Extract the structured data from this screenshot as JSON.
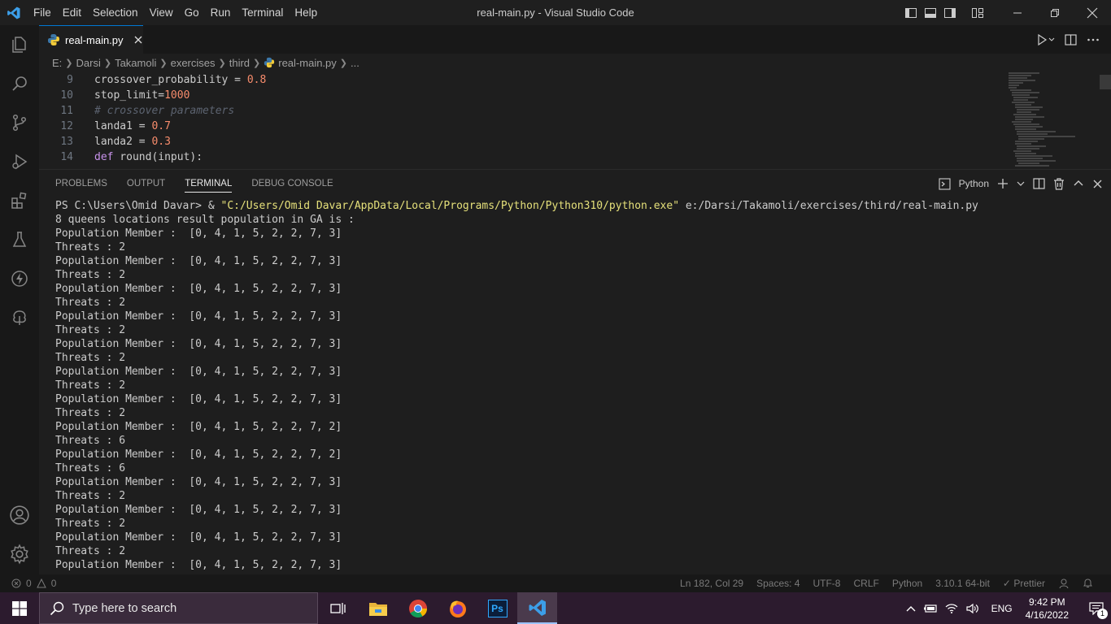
{
  "titlebar": {
    "menu": [
      "File",
      "Edit",
      "Selection",
      "View",
      "Go",
      "Run",
      "Terminal",
      "Help"
    ],
    "title": "real-main.py - Visual Studio Code"
  },
  "tab": {
    "label": "real-main.py"
  },
  "breadcrumb": [
    "E:",
    "Darsi",
    "Takamoli",
    "exercises",
    "third",
    "real-main.py",
    "..."
  ],
  "editor": {
    "lines": [
      {
        "n": "9",
        "pre": "crossover_probability = ",
        "val": "0.8"
      },
      {
        "n": "10",
        "pre": "stop_limit=",
        "val": "1000"
      },
      {
        "n": "11",
        "comment": "# crossover parameters"
      },
      {
        "n": "12",
        "pre": "landa1 = ",
        "val": "0.7"
      },
      {
        "n": "13",
        "pre": "landa2 = ",
        "val": "0.3"
      },
      {
        "n": "14",
        "kw": "def",
        "rest": " round(input):"
      }
    ]
  },
  "panel": {
    "tabs": [
      "PROBLEMS",
      "OUTPUT",
      "TERMINAL",
      "DEBUG CONSOLE"
    ],
    "active_tab": "TERMINAL",
    "shell": "Python"
  },
  "terminal": {
    "prompt": "PS C:\\Users\\Omid Davar> & ",
    "exe": "\"C:/Users/Omid Davar/AppData/Local/Programs/Python/Python310/python.exe\"",
    "script": " e:/Darsi/Takamoli/exercises/third/real-main.py",
    "header": "8 queens locations result population in GA is :",
    "output": [
      "Population Member :  [0, 4, 1, 5, 2, 2, 7, 3]",
      "Threats : 2",
      "Population Member :  [0, 4, 1, 5, 2, 2, 7, 3]",
      "Threats : 2",
      "Population Member :  [0, 4, 1, 5, 2, 2, 7, 3]",
      "Threats : 2",
      "Population Member :  [0, 4, 1, 5, 2, 2, 7, 3]",
      "Threats : 2",
      "Population Member :  [0, 4, 1, 5, 2, 2, 7, 3]",
      "Threats : 2",
      "Population Member :  [0, 4, 1, 5, 2, 2, 7, 3]",
      "Threats : 2",
      "Population Member :  [0, 4, 1, 5, 2, 2, 7, 3]",
      "Threats : 2",
      "Population Member :  [0, 4, 1, 5, 2, 2, 7, 2]",
      "Threats : 6",
      "Population Member :  [0, 4, 1, 5, 2, 2, 7, 2]",
      "Threats : 6",
      "Population Member :  [0, 4, 1, 5, 2, 2, 7, 3]",
      "Threats : 2",
      "Population Member :  [0, 4, 1, 5, 2, 2, 7, 3]",
      "Threats : 2",
      "Population Member :  [0, 4, 1, 5, 2, 2, 7, 3]",
      "Threats : 2",
      "Population Member :  [0, 4, 1, 5, 2, 2, 7, 3]"
    ]
  },
  "status": {
    "errors": "0",
    "warnings": "0",
    "position": "Ln 182, Col 29",
    "spaces": "Spaces: 4",
    "encoding": "UTF-8",
    "eol": "CRLF",
    "language": "Python",
    "interpreter": "3.10.1 64-bit",
    "formatter": "Prettier"
  },
  "taskbar": {
    "search_placeholder": "Type here to search",
    "apps": [
      "task-view-icon",
      "file-explorer-icon",
      "chrome-icon",
      "firefox-icon",
      "photoshop-icon",
      "vscode-icon"
    ],
    "photoshop_label": "Ps",
    "language": "ENG",
    "time": "9:42 PM",
    "date": "4/16/2022",
    "notifications": "1"
  }
}
